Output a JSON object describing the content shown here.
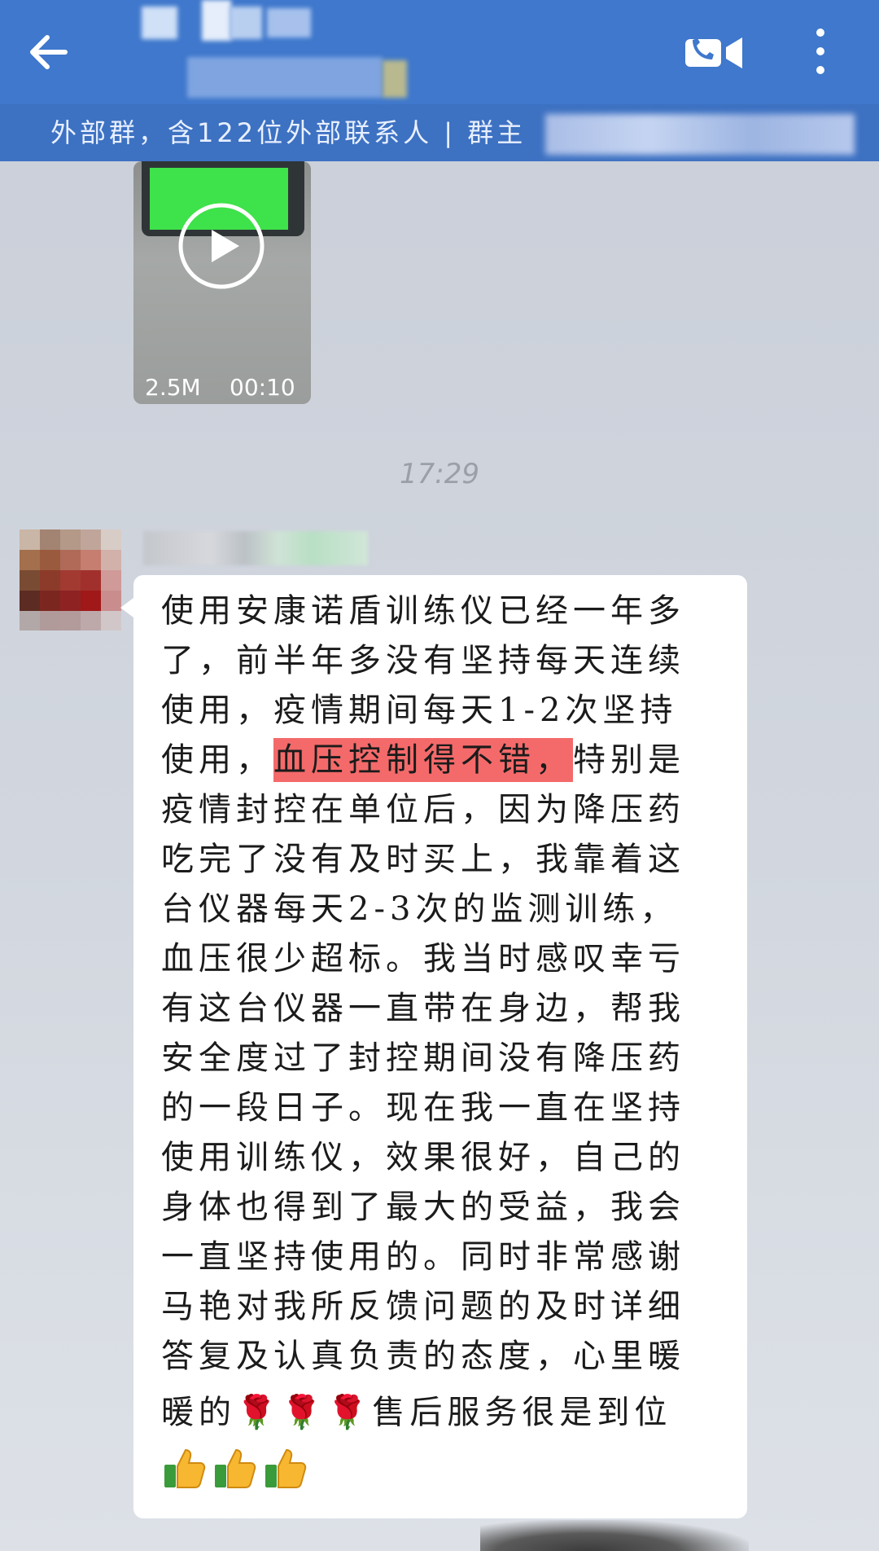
{
  "header": {
    "subtitle": "外部群，含122位外部联系人 | 群主",
    "back_icon": "arrow-left-icon",
    "call_icon": "video-call-icon",
    "more_icon": "more-vertical-icon",
    "bar_color": "#3f78cc"
  },
  "video": {
    "size": "2.5M",
    "duration": "00:10",
    "play_icon": "play-icon"
  },
  "chat": {
    "timestamp": "17:29",
    "message": {
      "lines": [
        "使用安康诺盾训练仪已经一年多",
        "了，前半年多没有坚持每天连续",
        "使用，疫情期间每天1-2次坚持",
        [
          "使用，",
          "血压控制得不错，",
          "特别是"
        ],
        "疫情封控在单位后，因为降压药",
        "吃完了没有及时买上，我靠着这",
        "台仪器每天2-3次的监测训练，",
        "血压很少超标。我当时感叹幸亏",
        "有这台仪器一直带在身边，帮我",
        "安全度过了封控期间没有降压药",
        "的一段日子。现在我一直在坚持",
        "使用训练仪，效果很好，自己的",
        "身体也得到了最大的受益，我会",
        "一直坚持使用的。同时非常感谢",
        "马艳对我所反馈问题的及时详细",
        "答复及认真负责的态度，心里暖"
      ],
      "last_line_text_1": "暖的",
      "roses": "🌹🌹🌹",
      "last_line_text_2": "售后服务很是到位",
      "thumbs_count": 3,
      "highlight_color": "#f46a6a"
    }
  }
}
